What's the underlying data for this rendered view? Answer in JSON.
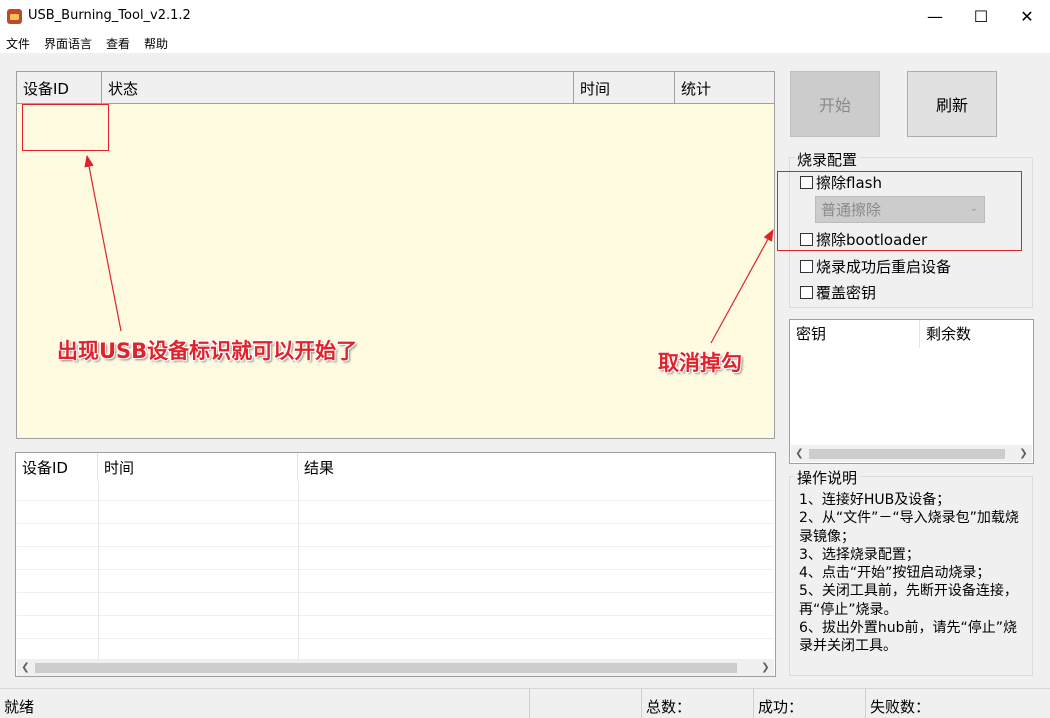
{
  "window": {
    "title": "USB_Burning_Tool_v2.1.2",
    "minimize": "—",
    "maximize": "☐",
    "close": "✕"
  },
  "menu": [
    "文件",
    "界面语言",
    "查看",
    "帮助"
  ],
  "device_table": {
    "columns": [
      "设备ID",
      "状态",
      "时间",
      "统计"
    ]
  },
  "result_table": {
    "columns": [
      "设备ID",
      "时间",
      "结果"
    ]
  },
  "buttons": {
    "start": "开始",
    "refresh": "刷新"
  },
  "burn_config": {
    "title": "烧录配置",
    "erase_flash": "擦除flash",
    "erase_mode": "普通擦除",
    "erase_bootloader": "擦除bootloader",
    "reboot_after": "烧录成功后重启设备",
    "overwrite_key": "覆盖密钥"
  },
  "key_table": {
    "columns": [
      "密钥",
      "剩余数"
    ]
  },
  "instructions": {
    "title": "操作说明",
    "lines": [
      "1、连接好HUB及设备；",
      "2、从“文件”－“导入烧录包”加载烧录镜像；",
      "3、选择烧录配置；",
      "4、点击“开始”按钮启动烧录；",
      "5、关闭工具前，先断开设备连接，再“停止”烧录。",
      "6、拔出外置hub前，请先“停止”烧录并关闭工具。"
    ]
  },
  "annotations": {
    "left": "出现USB设备标识就可以开始了",
    "right": "取消掉勾"
  },
  "statusbar": {
    "status": "就绪",
    "total": "总数：",
    "success": "成功：",
    "fail": "失败数："
  },
  "colors": {
    "device_panel_bg": "#fffbe1",
    "annotation_red": "#e0232b",
    "disabled_button": "#cccccc"
  },
  "icons": {
    "app": "usb-tool-icon",
    "scroll_left": "chevron-left-icon",
    "scroll_right": "chevron-right-icon",
    "dropdown": "chevron-down-icon"
  }
}
